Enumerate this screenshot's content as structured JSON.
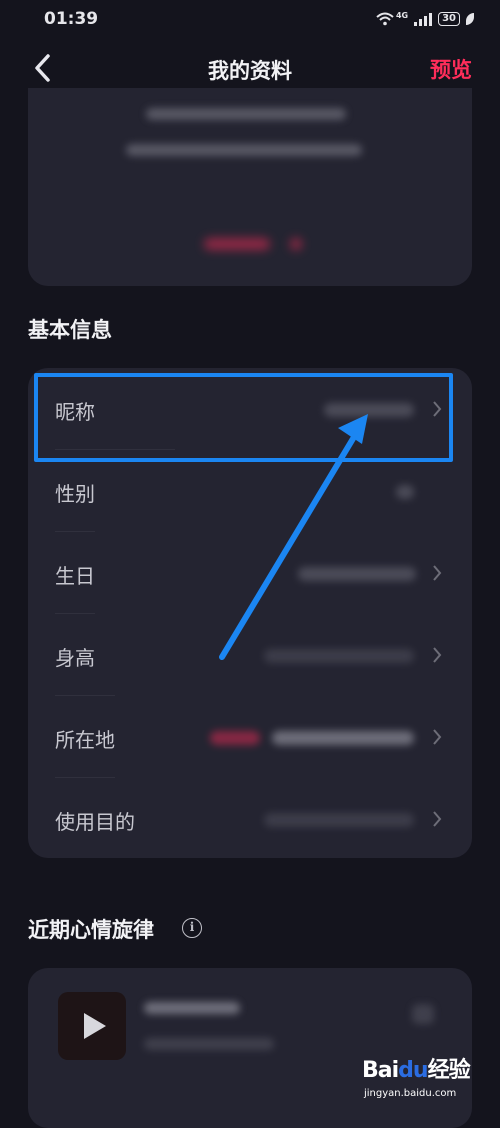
{
  "status_bar": {
    "time": "01:39",
    "network": "4G",
    "battery": "30"
  },
  "nav": {
    "title": "我的资料",
    "preview_label": "预览"
  },
  "sections": {
    "basic_info_title": "基本信息",
    "mood_title": "近期心情旋律"
  },
  "basic_info": {
    "rows": [
      {
        "label": "昵称"
      },
      {
        "label": "性别"
      },
      {
        "label": "生日"
      },
      {
        "label": "身高"
      },
      {
        "label": "所在地"
      },
      {
        "label": "使用目的"
      }
    ]
  },
  "icons": {
    "back": "chevron-left-icon",
    "row_chevron": "chevron-right-icon",
    "info": "info-icon",
    "play": "play-icon",
    "wifi": "wifi-icon",
    "signal": "signal-icon",
    "battery": "battery-icon"
  },
  "info_icon_glyph": "i",
  "watermark": {
    "main_prefix": "Bai",
    "main_paw": "du",
    "main_suffix": "经验",
    "sub": "jingyan.baidu.com"
  },
  "colors": {
    "accent": "#ff2d5a",
    "annotation": "#1b86f2",
    "background": "#14141d",
    "card": "#242431"
  }
}
